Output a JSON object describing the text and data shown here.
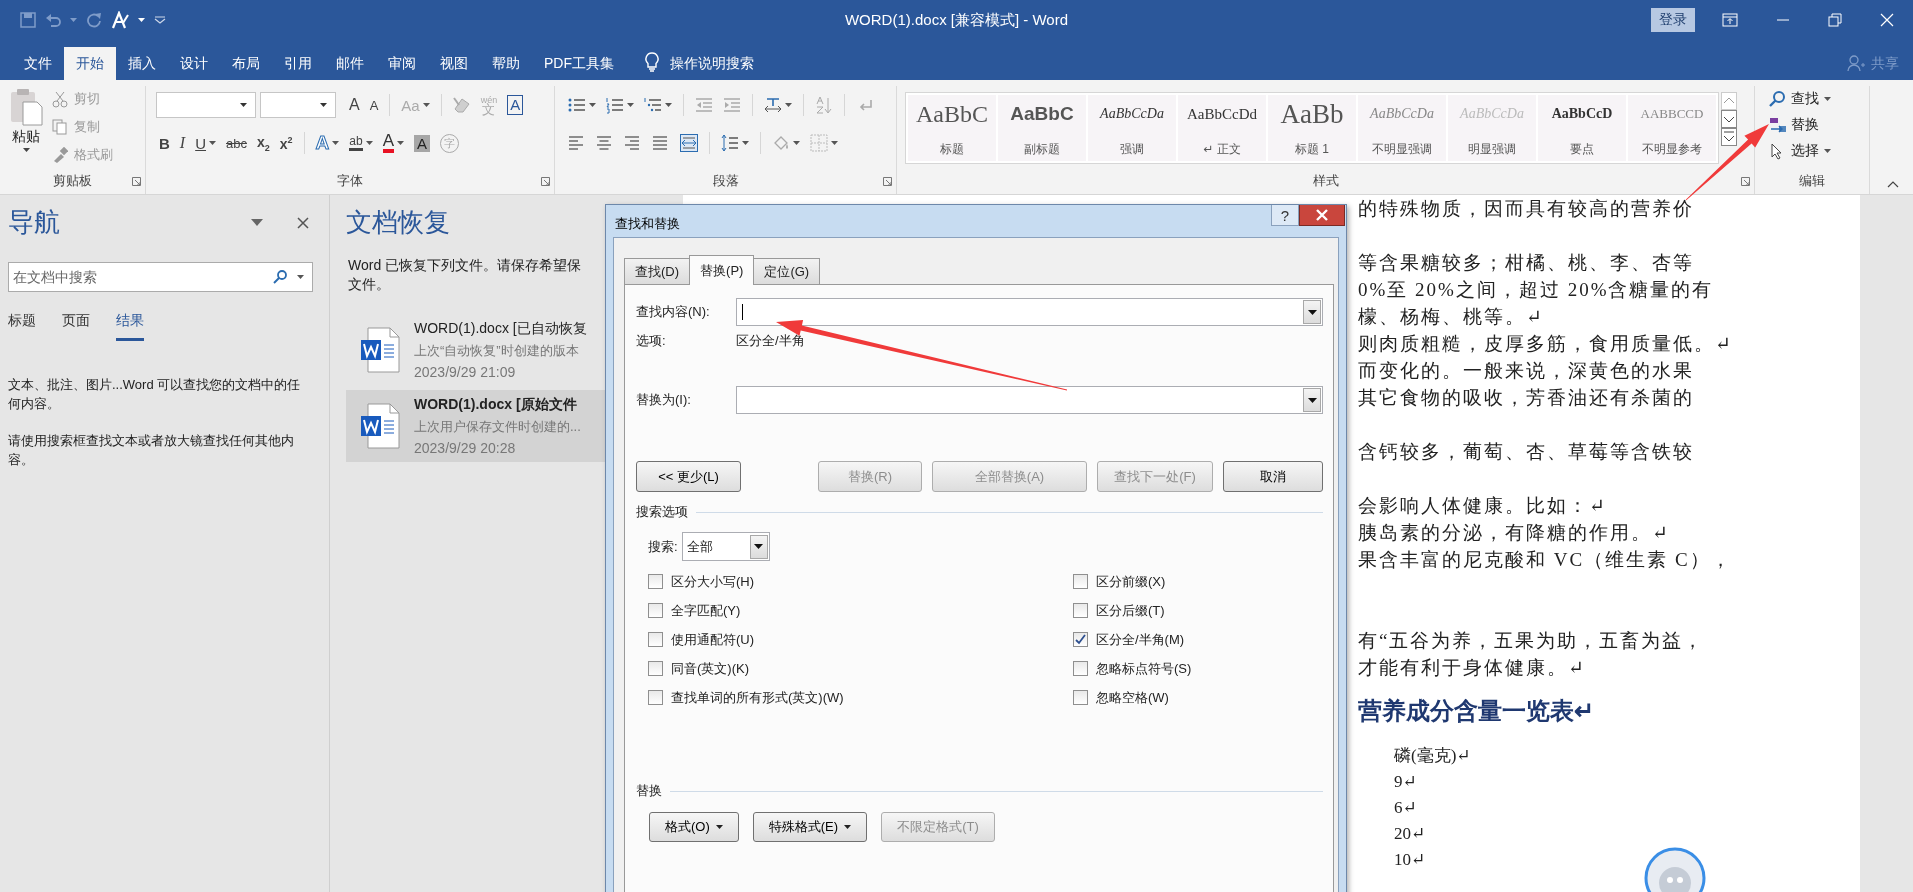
{
  "title_bar": {
    "title": "WORD(1).docx [兼容模式]  -  Word",
    "sign_in": "登录"
  },
  "menu_tabs": [
    {
      "label": "文件",
      "selected": false
    },
    {
      "label": "开始",
      "selected": true
    },
    {
      "label": "插入",
      "selected": false
    },
    {
      "label": "设计",
      "selected": false
    },
    {
      "label": "布局",
      "selected": false
    },
    {
      "label": "引用",
      "selected": false
    },
    {
      "label": "邮件",
      "selected": false
    },
    {
      "label": "审阅",
      "selected": false
    },
    {
      "label": "视图",
      "selected": false
    },
    {
      "label": "帮助",
      "selected": false
    },
    {
      "label": "PDF工具集",
      "selected": false
    }
  ],
  "tell_me": "操作说明搜索",
  "share": "共享",
  "ribbon": {
    "clipboard": {
      "label": "剪贴板",
      "paste": "粘贴",
      "actions": [
        {
          "label": "剪切",
          "kind": "cut",
          "disabled": true
        },
        {
          "label": "复制",
          "kind": "copy",
          "disabled": true
        },
        {
          "label": "格式刷",
          "kind": "painter",
          "disabled": true
        }
      ]
    },
    "font": {
      "label": "字体",
      "row1": [
        {
          "kind": "grow",
          "glyph": "A",
          "dropdown": false
        },
        {
          "kind": "shrink",
          "glyph": "A",
          "dropdown": false
        },
        {
          "kind": "case",
          "glyph": "Aa",
          "dropdown": true
        },
        {
          "kind": "clear",
          "dropdown": false
        },
        {
          "kind": "phonetic",
          "glyph": "文",
          "ruby": "wén",
          "dropdown": false
        },
        {
          "kind": "border",
          "glyph": "A",
          "dropdown": false
        }
      ],
      "row2": [
        {
          "kind": "bold",
          "glyph": "B",
          "dropdown": false
        },
        {
          "kind": "italic",
          "glyph": "I",
          "dropdown": false
        },
        {
          "kind": "underline",
          "glyph": "U",
          "dropdown": true
        },
        {
          "kind": "strike",
          "glyph": "abc",
          "dropdown": false
        },
        {
          "kind": "sub",
          "glyph": "x$_{2}$",
          "dropdown": false
        },
        {
          "kind": "sup",
          "glyph": "x$^{2}$",
          "dropdown": false
        },
        {
          "kind": "effects",
          "glyph": "A",
          "dropdown": true
        },
        {
          "kind": "highlight",
          "glyph": "ab",
          "dropdown": true
        },
        {
          "kind": "color",
          "glyph": "A",
          "dropdown": true
        },
        {
          "kind": "shade",
          "glyph": "A",
          "dropdown": false
        },
        {
          "kind": "enclose",
          "glyph": "字",
          "dropdown": false
        }
      ]
    },
    "paragraph": {
      "label": "段落"
    },
    "styles": {
      "label": "样式",
      "items": [
        {
          "sample": "AaBbC",
          "name": "标题",
          "kind": "title"
        },
        {
          "sample": "AaBbC",
          "name": "副标题",
          "kind": "subtitle"
        },
        {
          "sample": "AaBbCcDa",
          "name": "强调",
          "kind": "emphasis"
        },
        {
          "sample": "AaBbCcDd",
          "name": "↵ 正文",
          "kind": "normal"
        },
        {
          "sample": "AaBb",
          "name": "标题 1",
          "kind": "heading1"
        },
        {
          "sample": "AaBbCcDa",
          "name": "不明显强调",
          "kind": "subtle"
        },
        {
          "sample": "AaBbCcDa",
          "name": "明显强调",
          "kind": "intense"
        },
        {
          "sample": "AaBbCcD",
          "name": "要点",
          "kind": "strong"
        },
        {
          "sample": "AABBCCD",
          "name": "不明显参考",
          "kind": "reference"
        }
      ]
    },
    "editing": {
      "label": "编辑",
      "items": [
        {
          "label": "查找",
          "kind": "find"
        },
        {
          "label": "替换",
          "kind": "replace"
        },
        {
          "label": "选择",
          "kind": "select"
        }
      ]
    }
  },
  "navigation": {
    "title": "导航",
    "search": {
      "placeholder": "在文档中搜索"
    },
    "tabs": [
      {
        "label": "标题",
        "selected": false
      },
      {
        "label": "页面",
        "selected": false
      },
      {
        "label": "结果",
        "selected": true
      }
    ],
    "paragraphs": [
      "文本、批注、图片...Word 可以查找您的文档中的任何内容。",
      "请使用搜索框查找文本或者放大镜查找任何其他内容。"
    ]
  },
  "recovery": {
    "title": "文档恢复",
    "intro": [
      "Word 已恢复下列文件。请保存希望保",
      "文件。"
    ],
    "files": [
      {
        "name": "WORD(1).docx  [已自动恢复",
        "note": "上次“自动恢复”时创建的版本",
        "time": "2023/9/29 21:09",
        "selected": false
      },
      {
        "name": "WORD(1).docx  [原始文件",
        "note": "上次用户保存文件时创建的...",
        "time": "2023/9/29 20:28",
        "selected": true
      }
    ]
  },
  "document": {
    "lines": [
      {
        "kind": "text",
        "text": "的特殊物质，因而具有较高的营养价"
      },
      {
        "kind": "blank"
      },
      {
        "kind": "text",
        "text": "等含果糖较多；柑橘、桃、李、杏等"
      },
      {
        "kind": "text",
        "text": "0%至 20%之间，超过 20%含糖量的有"
      },
      {
        "kind": "text",
        "text": "檬、杨梅、桃等。↵"
      },
      {
        "kind": "text",
        "text": "则肉质粗糙，皮厚多筋，食用质量低。↵"
      },
      {
        "kind": "text",
        "text": "而变化的。一般来说，深黄色的水果"
      },
      {
        "kind": "text",
        "text": "其它食物的吸收，芳香油还有杀菌的"
      },
      {
        "kind": "blank"
      },
      {
        "kind": "text",
        "text": "含钙较多，葡萄、杏、草莓等含铁较"
      },
      {
        "kind": "blank"
      },
      {
        "kind": "text",
        "text": "会影响人体健康。比如：↵"
      },
      {
        "kind": "text",
        "text": "胰岛素的分泌，有降糖的作用。↵"
      },
      {
        "kind": "text",
        "text": "果含丰富的尼克酸和 VC（维生素 C），"
      },
      {
        "kind": "blank"
      },
      {
        "kind": "blank"
      },
      {
        "kind": "text",
        "text": "有“五谷为养，五果为助，五畜为益，"
      },
      {
        "kind": "text",
        "text": "才能有利于身体健康。↵"
      },
      {
        "kind": "heading",
        "text": "营养成分含量一览表↵"
      },
      {
        "kind": "cell",
        "text": "磷(毫克)↵"
      },
      {
        "kind": "cell",
        "text": "9↵"
      },
      {
        "kind": "cell",
        "text": "6↵"
      },
      {
        "kind": "cell",
        "text": "20↵"
      },
      {
        "kind": "cell",
        "text": "10↵"
      }
    ]
  },
  "dialog": {
    "title": "查找和替换",
    "help": "?",
    "tabs": [
      {
        "label": "查找(D)",
        "selected": false
      },
      {
        "label": "替换(P)",
        "selected": true
      },
      {
        "label": "定位(G)",
        "selected": false
      }
    ],
    "find": {
      "label": "查找内容(N):",
      "focused": true
    },
    "options": {
      "label": "选项:",
      "value": "区分全/半角"
    },
    "replace": {
      "label": "替换为(I):",
      "focused": false
    },
    "buttons": [
      {
        "label": "<< 更少(L)",
        "disabled": false
      },
      {
        "label": "替换(R)",
        "disabled": true
      },
      {
        "label": "全部替换(A)",
        "disabled": true
      },
      {
        "label": "查找下一处(F)",
        "disabled": true
      },
      {
        "label": "取消",
        "disabled": false
      }
    ],
    "search_options": {
      "title": "搜索选项",
      "search_label": "搜索:",
      "search_value": "全部",
      "left": [
        {
          "label": "区分大小写(H)",
          "checked": false
        },
        {
          "label": "全字匹配(Y)",
          "checked": false
        },
        {
          "label": "使用通配符(U)",
          "checked": false
        },
        {
          "label": "同音(英文)(K)",
          "checked": false
        },
        {
          "label": "查找单词的所有形式(英文)(W)",
          "checked": false
        }
      ],
      "right": [
        {
          "label": "区分前缀(X)",
          "checked": false
        },
        {
          "label": "区分后缀(T)",
          "checked": false
        },
        {
          "label": "区分全/半角(M)",
          "checked": true
        },
        {
          "label": "忽略标点符号(S)",
          "checked": false
        },
        {
          "label": "忽略空格(W)",
          "checked": false
        }
      ]
    },
    "replace_section": {
      "title": "替换",
      "buttons": [
        {
          "label": "格式(O)",
          "dropdown": true,
          "disabled": false
        },
        {
          "label": "特殊格式(E)",
          "dropdown": true,
          "disabled": false
        },
        {
          "label": "不限定格式(T)",
          "dropdown": false,
          "disabled": true
        }
      ]
    }
  }
}
